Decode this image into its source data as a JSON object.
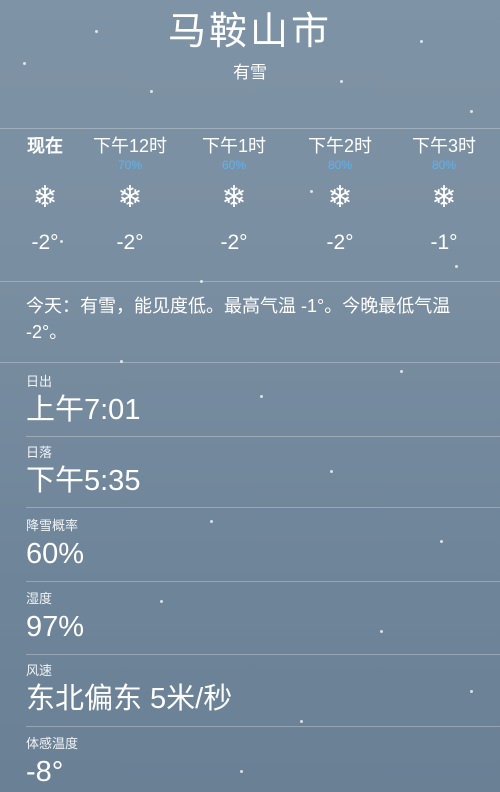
{
  "header": {
    "city": "马鞍山市",
    "condition": "有雪"
  },
  "hourly": [
    {
      "time": "现在",
      "precip": "",
      "icon": "snowflake-icon",
      "temp": "-2°"
    },
    {
      "time": "下午12时",
      "precip": "70%",
      "icon": "snowflake-icon",
      "temp": "-2°"
    },
    {
      "time": "下午1时",
      "precip": "60%",
      "icon": "snowflake-icon",
      "temp": "-2°"
    },
    {
      "time": "下午2时",
      "precip": "80%",
      "icon": "snowflake-icon",
      "temp": "-2°"
    },
    {
      "time": "下午3时",
      "precip": "80%",
      "icon": "snowflake-icon",
      "temp": "-1°"
    }
  ],
  "summary": "今天：有雪，能见度低。最高气温 -1°。今晚最低气温 -2°。",
  "details": [
    {
      "label": "日出",
      "value": "上午7:01"
    },
    {
      "label": "日落",
      "value": "下午5:35"
    },
    {
      "label": "降雪概率",
      "value": "60%"
    },
    {
      "label": "湿度",
      "value": "97%"
    },
    {
      "label": "风速",
      "value": "东北偏东 5米/秒"
    },
    {
      "label": "体感温度",
      "value": "-8°"
    }
  ],
  "colors": {
    "background": "#7a8ea1",
    "precip_text": "#5fb3ef"
  }
}
